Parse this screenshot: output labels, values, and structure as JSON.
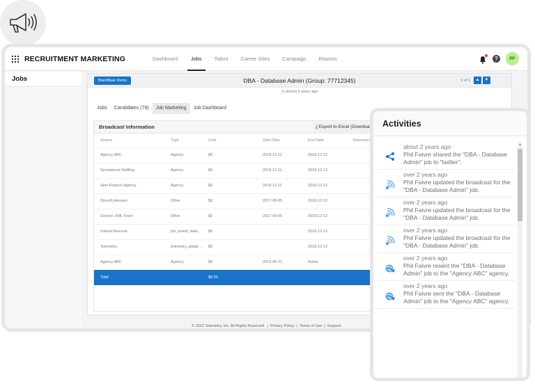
{
  "app": {
    "brand": "RECRUITMENT MARKETING",
    "nav": [
      "Dashboard",
      "Jobs",
      "Talent",
      "Career Sites",
      "Campaign",
      "Reports"
    ],
    "active_nav": "Jobs",
    "avatar_initials": "PF",
    "accent_color": "#1a73c8"
  },
  "sidebar": {
    "title": "Jobs"
  },
  "job": {
    "badge": "BlackBear Demo",
    "title": "DBA - Database Admin (Group: 77712345)",
    "pager": "1 of 1",
    "updated": "almost 3 years ago",
    "subtabs": [
      "Jobs",
      "Candidates (79)",
      "Job Marketing",
      "Job Dashboard"
    ],
    "active_subtab": "Job Marketing"
  },
  "broadcast": {
    "title": "Broadcast Information",
    "export_label": "Export to Excel (Download)",
    "columns": [
      "Source",
      "Type",
      "Cost",
      "Start Date",
      "End Date",
      "Removal D"
    ],
    "rows": [
      [
        "Agency ABC",
        "Agency",
        "$0",
        "2018-11-21",
        "2018-12-12"
      ],
      [
        "Sensational Staffing",
        "Agency",
        "$0",
        "2018-11-21",
        "2018-12-12"
      ],
      [
        "New Finance Agency",
        "Agency",
        "$0",
        "2018-11-21",
        "2018-12-12"
      ],
      [
        "Direct/Unknown",
        "Other",
        "$0",
        "2017-09-05",
        "2018-12-12"
      ],
      [
        "Generic XML Feed",
        "Other",
        "$0",
        "2017-09-05",
        "2018-12-12"
      ],
      [
        "Indeed Resume",
        "job_board_database",
        "$0",
        "",
        "2018-12-12"
      ],
      [
        "Telemetry",
        "telemetry_database",
        "$0",
        "",
        "2018-12-12"
      ],
      [
        "Agency ABC",
        "Agency",
        "$0",
        "2019-06-21",
        "Active"
      ]
    ],
    "total_label": "Total",
    "total_cost": "$0.00"
  },
  "footer": {
    "copyright": "© 2022 Telemetry, Inc. All Rights Reserved.",
    "links": [
      "Privacy Policy",
      "Terms of Use",
      "Support"
    ]
  },
  "activities": {
    "title": "Activities",
    "items": [
      {
        "icon": "share-icon",
        "time": "about 2 years ago",
        "text": "Phil Faivre shared the \"DBA - Database Admin\" job to \"twitter\"."
      },
      {
        "icon": "broadcast-icon",
        "time": "over 2 years ago",
        "text": "Phil Faivre updated the broadcast for the \"DBA - Database Admin\" job."
      },
      {
        "icon": "broadcast-icon",
        "time": "over 2 years ago",
        "text": "Phil Faivre updated the broadcast for the \"DBA - Database Admin\" job."
      },
      {
        "icon": "broadcast-icon",
        "time": "over 2 years ago",
        "text": "Phil Faivre updated the broadcast for the \"DBA - Database Admin\" job."
      },
      {
        "icon": "send-globe-icon",
        "time": "over 2 years ago",
        "text": "Phil Faivre resent the \"DBA - Database Admin\" job to the \"Agency ABC\" agency."
      },
      {
        "icon": "send-globe-icon",
        "time": "over 2 years ago",
        "text": "Phil Faivre sent the \"DBA - Database Admin\" job to the \"Agency ABC\" agency."
      }
    ]
  }
}
